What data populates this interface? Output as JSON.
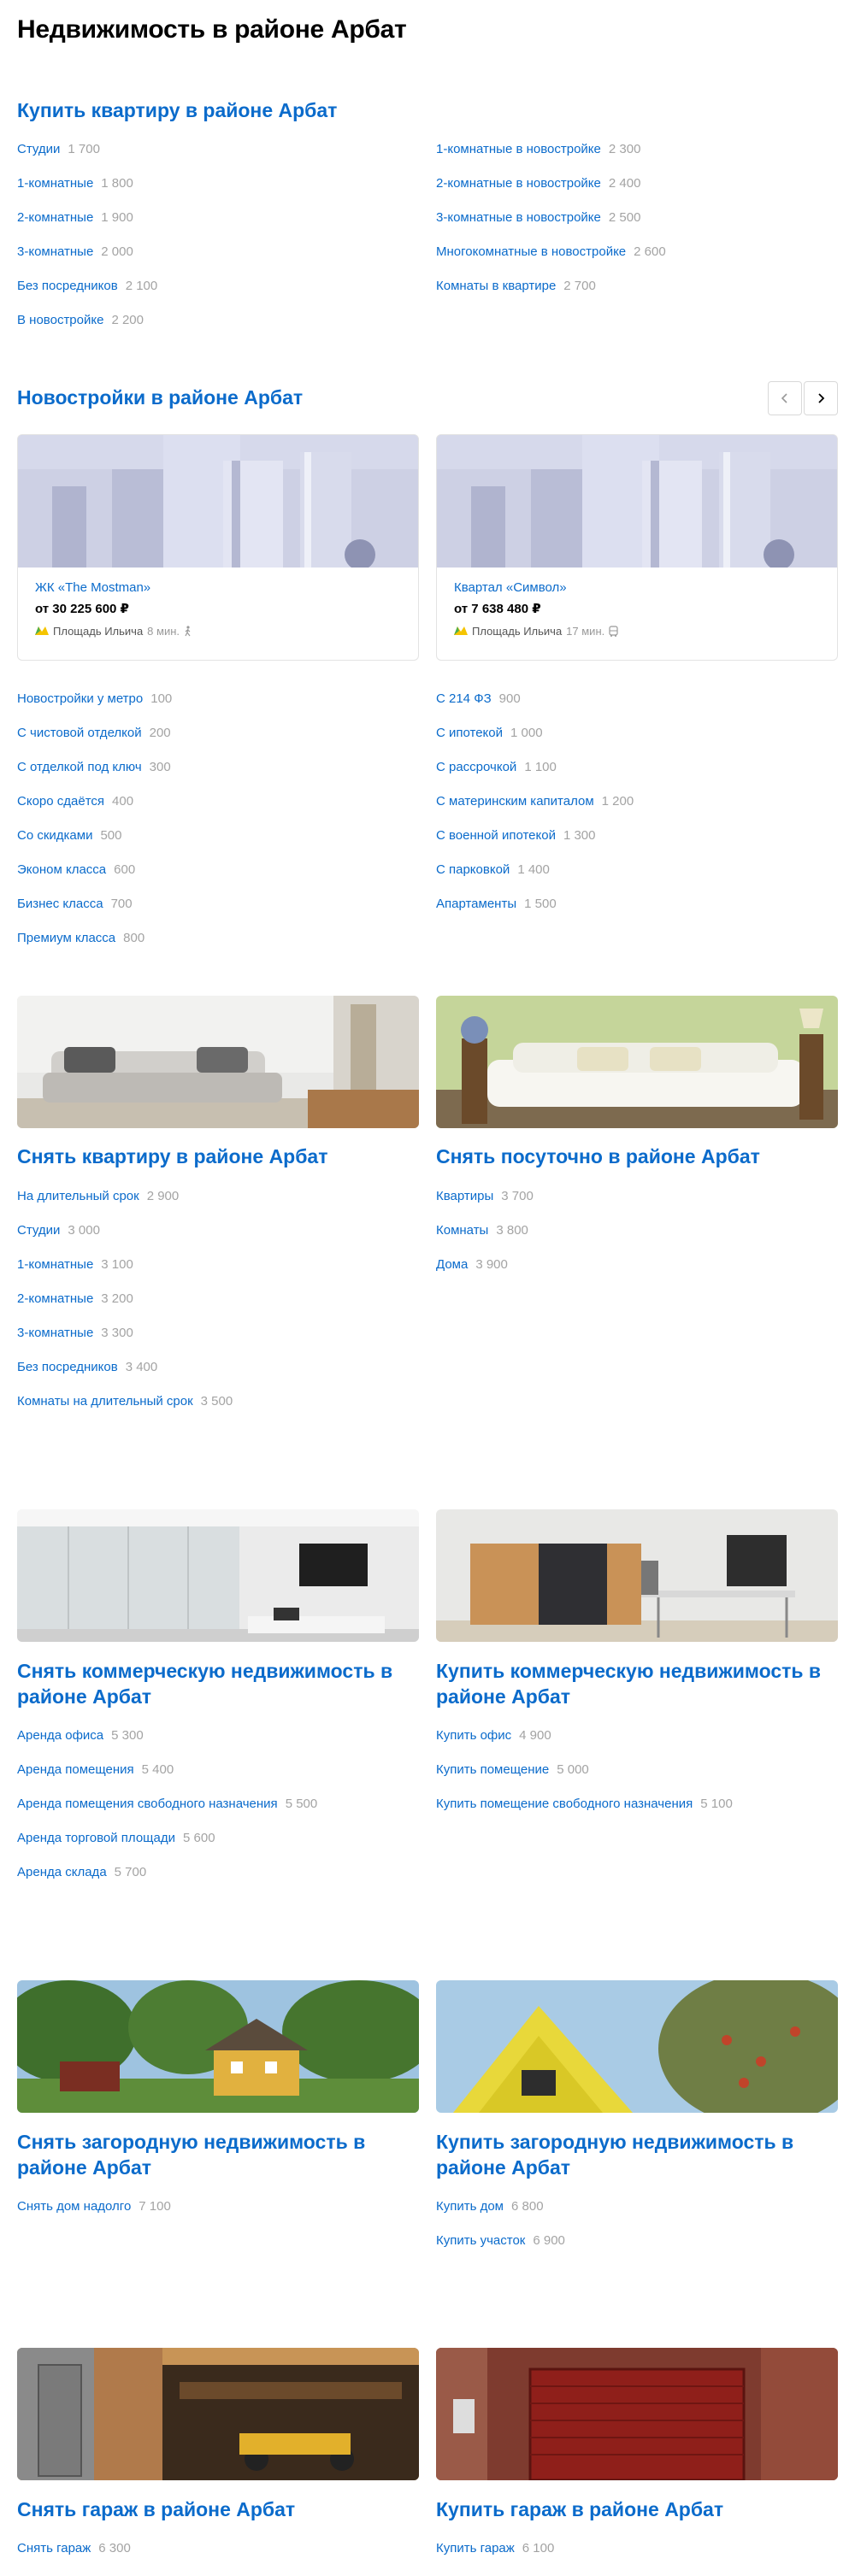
{
  "page_title": "Недвижимость в районе Арбат",
  "buy_flat": {
    "title": "Купить квартиру в районе Арбат",
    "left": [
      {
        "label": "Студии",
        "count": "1 700"
      },
      {
        "label": "1-комнатные",
        "count": "1 800"
      },
      {
        "label": "2-комнатные",
        "count": "1 900"
      },
      {
        "label": "3-комнатные",
        "count": "2 000"
      },
      {
        "label": "Без посредников",
        "count": "2 100"
      },
      {
        "label": "В новостройке",
        "count": "2 200"
      }
    ],
    "right": [
      {
        "label": "1-комнатные в новостройке",
        "count": "2 300"
      },
      {
        "label": "2-комнатные в новостройке",
        "count": "2 400"
      },
      {
        "label": "3-комнатные в новостройке",
        "count": "2 500"
      },
      {
        "label": "Многокомнатные в новостройке",
        "count": "2 600"
      },
      {
        "label": "Комнаты в квартире",
        "count": "2 700"
      }
    ]
  },
  "new_buildings": {
    "title": "Новостройки в районе Арбат",
    "cards": [
      {
        "name": "ЖК «The Mostman»",
        "price": "от 30 225 600 ₽",
        "metro": "Площадь Ильича",
        "time": "8 мин.",
        "transport_icon": "walk-icon"
      },
      {
        "name": "Квартал «Символ»",
        "price": "от 7 638 480 ₽",
        "metro": "Площадь Ильича",
        "time": "17 мин.",
        "transport_icon": "bus-icon"
      }
    ],
    "left": [
      {
        "label": "Новостройки у метро",
        "count": "100"
      },
      {
        "label": "С чистовой отделкой",
        "count": "200"
      },
      {
        "label": "С отделкой под ключ",
        "count": "300"
      },
      {
        "label": "Скоро сдаётся",
        "count": "400"
      },
      {
        "label": "Со скидками",
        "count": "500"
      },
      {
        "label": "Эконом класса",
        "count": "600"
      },
      {
        "label": "Бизнес класса",
        "count": "700"
      },
      {
        "label": "Премиум класса",
        "count": "800"
      }
    ],
    "right": [
      {
        "label": "С 214 ФЗ",
        "count": "900"
      },
      {
        "label": "С ипотекой",
        "count": "1 000"
      },
      {
        "label": "С рассрочкой",
        "count": "1 100"
      },
      {
        "label": "С материнским капиталом",
        "count": "1 200"
      },
      {
        "label": "С военной ипотекой",
        "count": "1 300"
      },
      {
        "label": "С парковкой",
        "count": "1 400"
      },
      {
        "label": "Апартаменты",
        "count": "1 500"
      }
    ]
  },
  "rent_flat": {
    "title": "Снять квартиру в районе Арбат",
    "items": [
      {
        "label": "На длительный срок",
        "count": "2 900"
      },
      {
        "label": "Студии",
        "count": "3 000"
      },
      {
        "label": "1-комнатные",
        "count": "3 100"
      },
      {
        "label": "2-комнатные",
        "count": "3 200"
      },
      {
        "label": "3-комнатные",
        "count": "3 300"
      },
      {
        "label": "Без посредников",
        "count": "3 400"
      },
      {
        "label": "Комнаты на длительный срок",
        "count": "3 500"
      }
    ]
  },
  "daily": {
    "title": "Снять посуточно в районе Арбат",
    "items": [
      {
        "label": "Квартиры",
        "count": "3 700"
      },
      {
        "label": "Комнаты",
        "count": "3 800"
      },
      {
        "label": "Дома",
        "count": "3 900"
      }
    ]
  },
  "rent_commercial": {
    "title_line1": "Снять коммерческую недвижимость в",
    "title_line2": "районе Арбат",
    "items": [
      {
        "label": "Аренда офиса",
        "count": "5 300"
      },
      {
        "label": "Аренда помещения",
        "count": "5 400"
      },
      {
        "label": "Аренда помещения свободного назначения",
        "count": "5 500"
      },
      {
        "label": "Аренда торговой площади",
        "count": "5 600"
      },
      {
        "label": "Аренда склада",
        "count": "5 700"
      }
    ]
  },
  "buy_commercial": {
    "title_line1": "Купить коммерческую недвижимость в",
    "title_line2": "районе Арбат",
    "items": [
      {
        "label": "Купить офис",
        "count": "4 900"
      },
      {
        "label": "Купить помещение",
        "count": "5 000"
      },
      {
        "label": "Купить помещение свободного назначения",
        "count": "5 100"
      }
    ]
  },
  "rent_country": {
    "title_line1": "Снять загородную недвижимость в",
    "title_line2": "районе Арбат",
    "items": [
      {
        "label": "Снять дом надолго",
        "count": "7 100"
      }
    ]
  },
  "buy_country": {
    "title_line1": "Купить загородную недвижимость в",
    "title_line2": "районе Арбат",
    "items": [
      {
        "label": "Купить дом",
        "count": "6 800"
      },
      {
        "label": "Купить участок",
        "count": "6 900"
      }
    ]
  },
  "rent_garage": {
    "title": "Снять гараж в районе Арбат",
    "items": [
      {
        "label": "Снять гараж",
        "count": "6 300"
      }
    ]
  },
  "buy_garage": {
    "title": "Купить гараж в районе Арбат",
    "items": [
      {
        "label": "Купить гараж",
        "count": "6 100"
      }
    ]
  },
  "colors": {
    "link": "#0b6bcb",
    "count": "#a3a3a3",
    "metro": "#f5c400"
  }
}
